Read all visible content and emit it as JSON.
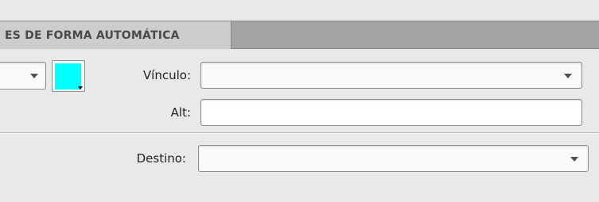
{
  "tab": {
    "label": "ES DE FORMA AUTOMÁTICA"
  },
  "form": {
    "vinculo_label": "Vínculo:",
    "alt_label": "Alt:",
    "destino_label": "Destino:",
    "vinculo_value": "",
    "alt_value": "",
    "destino_value": ""
  },
  "colors": {
    "swatch": "#00ffff",
    "panel_bg": "#e9e9e9",
    "tab_strip_bg": "#a4a4a4",
    "active_tab_bg": "#cdcdcd"
  },
  "icons": {
    "dropdown": "chevron-down-icon"
  }
}
